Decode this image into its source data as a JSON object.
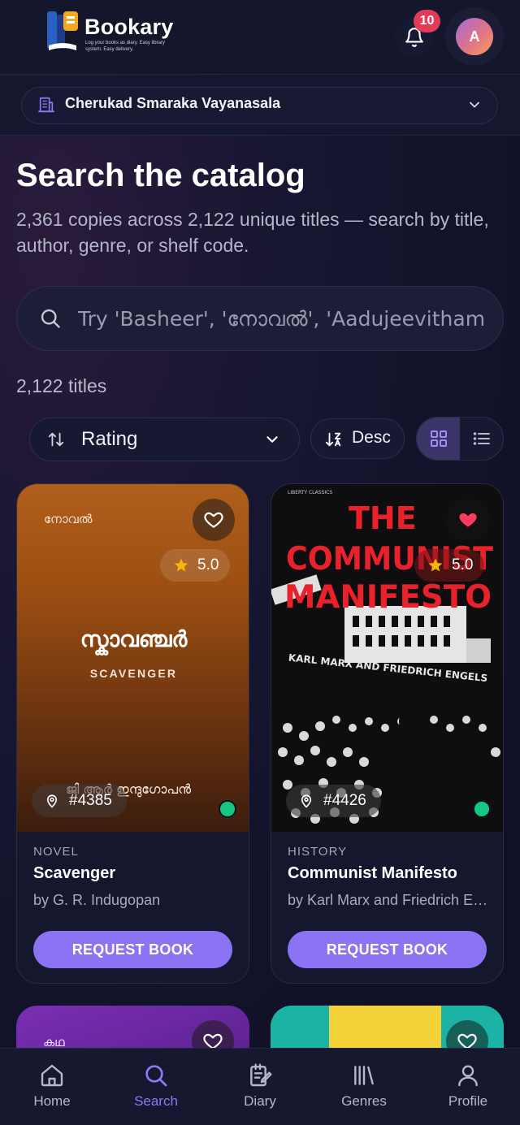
{
  "header": {
    "brand": "Bookary",
    "tagline": "Log your books as diary. Easy library system. Easy delivery.",
    "notification_count": "10",
    "avatar_initial": "A"
  },
  "library_selector": {
    "selected": "Cherukad Smaraka Vayanasala"
  },
  "page": {
    "title": "Search the catalog",
    "subtitle": "2,361 copies across 2,122 unique titles — search by title, author, genre, or shelf code."
  },
  "search": {
    "placeholder": "Try 'Basheer', 'നോവൽ', 'Aadujeevitham'",
    "value": ""
  },
  "results": {
    "count_label": "2,122 titles"
  },
  "controls": {
    "sort_by": "Rating",
    "order": "Desc",
    "view_mode": "grid"
  },
  "books": [
    {
      "genre": "NOVEL",
      "title": "Scavenger",
      "author": "by G. R. Indugopan",
      "rating": "5.0",
      "shelf": "#4385",
      "favorite": false,
      "available": true,
      "request_label": "REQUEST BOOK",
      "cover": {
        "genre_ml": "നോവൽ",
        "title_ml": "സ്കാവഞ്ചർ",
        "title_en": "SCAVENGER",
        "author_ml": "ജി ആർ ഇന്ദുഗോപൻ"
      }
    },
    {
      "genre": "HISTORY",
      "title": "Communist Manifesto",
      "author": "by Karl Marx and Friedrich Engels",
      "rating": "5.0",
      "shelf": "#4426",
      "favorite": true,
      "available": true,
      "request_label": "REQUEST BOOK",
      "cover": {
        "title_line1": "THE",
        "title_line2": "COMMUNIST",
        "title_line3": "MANIFESTO",
        "byline": "KARL MARX AND FRIEDRICH ENGELS",
        "publisher": "LIBERTY CLASSICS"
      }
    }
  ],
  "peek_books": [
    {
      "cover_text": "കഥ"
    },
    {
      "cover_text": ""
    }
  ],
  "nav": [
    {
      "label": "Home",
      "icon": "home-icon",
      "active": false
    },
    {
      "label": "Search",
      "icon": "search-icon",
      "active": true
    },
    {
      "label": "Diary",
      "icon": "diary-icon",
      "active": false
    },
    {
      "label": "Genres",
      "icon": "genres-icon",
      "active": false
    },
    {
      "label": "Profile",
      "icon": "profile-icon",
      "active": false
    }
  ],
  "colors": {
    "accent": "#8b73f4",
    "badge": "#e23b58",
    "available": "#16c784",
    "favorite": "#ff3b5c",
    "star": "#f5b50a"
  }
}
